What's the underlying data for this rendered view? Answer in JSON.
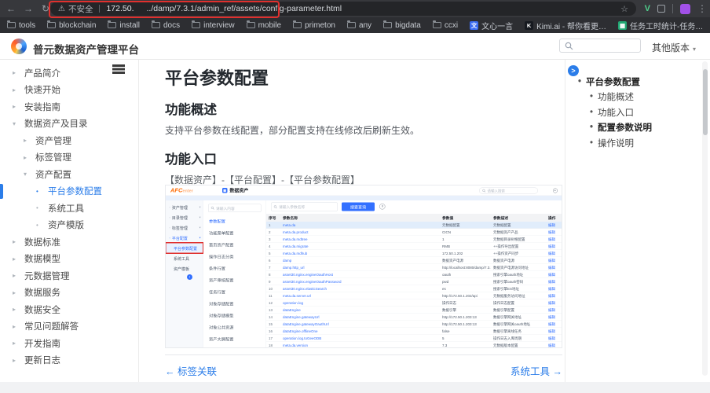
{
  "colors": {
    "accent_blue": "#2b7de9",
    "app_blue": "#3370ff",
    "annotation_red": "#e0302e",
    "brand_orange": "#ff6a00"
  },
  "browser": {
    "back_icon": "←",
    "forward_icon": "→",
    "reload_icon": "↻",
    "star_icon": "☆",
    "menu_icon": "⋮",
    "security_warning_icon": "⚠",
    "security_label": "不安全",
    "url_host": "172.50.",
    "url_path": "../damp/7.3.1/admin_ref/assets/config-parameter.html",
    "extension_v_label": "V",
    "folder_bookmarks": [
      "tools",
      "blockchain",
      "install",
      "docs",
      "interview",
      "mobile",
      "primeton",
      "any",
      "bigdata",
      "ccxi"
    ],
    "site_bookmarks": [
      {
        "label": "文心一言",
        "glyph": "文",
        "color": "#3b6cf0"
      },
      {
        "label": "Kimi.ai - 帮你看更…",
        "glyph": "K",
        "color": "#16191f"
      },
      {
        "label": "任务工时统计-任务…",
        "glyph": "▦",
        "color": "#21a673"
      }
    ]
  },
  "site": {
    "brand": "普元数据资产管理平台",
    "versions_label": "其他版本",
    "versions_caret": "▾"
  },
  "doc_sidebar": {
    "items": [
      {
        "label": "产品简介",
        "level": 0,
        "arrow": "right"
      },
      {
        "label": "快速开始",
        "level": 0,
        "arrow": "right"
      },
      {
        "label": "安装指南",
        "level": 0,
        "arrow": "right"
      },
      {
        "label": "数据资产及目录",
        "level": 0,
        "arrow": "down"
      },
      {
        "label": "资产管理",
        "level": 1,
        "arrow": "right"
      },
      {
        "label": "标签管理",
        "level": 1,
        "arrow": "right"
      },
      {
        "label": "资产配置",
        "level": 1,
        "arrow": "down"
      },
      {
        "label": "平台参数配置",
        "level": 2,
        "arrow": "dot",
        "active": true
      },
      {
        "label": "系统工具",
        "level": 2,
        "arrow": "dot"
      },
      {
        "label": "资产模版",
        "level": 2,
        "arrow": "dot"
      },
      {
        "label": "数据标准",
        "level": 0,
        "arrow": "right"
      },
      {
        "label": "数据模型",
        "level": 0,
        "arrow": "right"
      },
      {
        "label": "元数据管理",
        "level": 0,
        "arrow": "right"
      },
      {
        "label": "数据服务",
        "level": 0,
        "arrow": "right"
      },
      {
        "label": "数据安全",
        "level": 0,
        "arrow": "right"
      },
      {
        "label": "常见问题解答",
        "level": 0,
        "arrow": "right"
      },
      {
        "label": "开发指南",
        "level": 0,
        "arrow": "right"
      },
      {
        "label": "更新日志",
        "level": 0,
        "arrow": "right"
      }
    ]
  },
  "content": {
    "title": "平台参数配置",
    "section1_title": "功能概述",
    "section1_text": "支持平台参数在线配置，部分配置支持在线修改后刷新生效。",
    "section2_title": "功能入口",
    "entry_path": "【数据资产】-【平台配置】-【平台参数配置】"
  },
  "toc": {
    "expand_icon": ">",
    "items": [
      {
        "label": "平台参数配置",
        "level": 0,
        "bold": true
      },
      {
        "label": "功能概述",
        "level": 1,
        "bold": false
      },
      {
        "label": "功能入口",
        "level": 1,
        "bold": false
      },
      {
        "label": "配置参数说明",
        "level": 1,
        "bold": true
      },
      {
        "label": "操作说明",
        "level": 1,
        "bold": false
      }
    ]
  },
  "pager": {
    "prev_arrow": "←",
    "prev": "标签关联",
    "next": "系统工具",
    "next_arrow": "→"
  },
  "app_screenshot": {
    "logo_primary": "AFC",
    "logo_secondary": "enter",
    "top_tab": "数据资产",
    "top_tab_glyph": "▦",
    "top_search_placeholder": "请输入搜索",
    "nav_items": [
      {
        "label": "资产管理",
        "type": "parent"
      },
      {
        "label": "目录管理",
        "type": "parent"
      },
      {
        "label": "标签管理",
        "type": "parent"
      },
      {
        "label": "平台配置",
        "type": "parent",
        "active": true
      },
      {
        "label": "平台参数配置",
        "type": "child",
        "selected": true,
        "annotated": true
      },
      {
        "label": "系统工具",
        "type": "child"
      },
      {
        "label": "资产模板",
        "type": "child"
      }
    ],
    "collapse_icon": "i",
    "list_search_placeholder": "请输入内容",
    "list_items": [
      "参数配置",
      "功能菜单配置",
      "首页资产配置",
      "操作日志分类",
      "条件行置",
      "资产审核配置",
      "任务行置",
      "对象存储配置",
      "对象存储模型",
      "对象公共资源",
      "资产大屏配置"
    ],
    "table_search_placeholder": "请输入参数名称",
    "search_button": "搜索查询",
    "columns": [
      "序号",
      "参数名称",
      "参数值",
      "参数描述",
      "操作"
    ],
    "action_label": "编辑",
    "rows": [
      {
        "name": "meta.da",
        "value": "元数据配置",
        "desc": "元数据配置"
      },
      {
        "name": "meta.da.product",
        "value": "CICN",
        "desc": "元数据资产产品"
      },
      {
        "name": "meta.da.mdtree",
        "value": "1",
        "desc": "元数据目录树根配置"
      },
      {
        "name": "meta.da.migrate",
        "value": "RMB",
        "desc": "++操作导出配置"
      },
      {
        "name": "meta.da.mdhub",
        "value": "172.50.1.202",
        "desc": "++操作资产同步"
      },
      {
        "name": "damp",
        "value": "数据资产电源",
        "desc": "数据资产电源"
      },
      {
        "name": "damp.http_url",
        "value": "http://localhost:8080/damp/7.3.1",
        "desc": "数据资产电源访问地址"
      },
      {
        "name": "asset30.nginx.engineOauthHost",
        "value": "oauth",
        "desc": "搜索引擎oauth地址"
      },
      {
        "name": "asset30.nginx.engineOauthPassword",
        "value": "pwd",
        "desc": "搜索引擎oauth密码"
      },
      {
        "name": "asset30.nginx.elasticSearch",
        "value": "es",
        "desc": "搜索引擎ES地址"
      },
      {
        "name": "meta.da.server.url",
        "value": "http://172.50.1.202/api",
        "desc": "元数据服务访问地址"
      },
      {
        "name": "operation.log",
        "value": "操作日志",
        "desc": "操作日志配置"
      },
      {
        "name": "dataEngine",
        "value": "数据引擎",
        "desc": "数据引擎配置"
      },
      {
        "name": "dataEngine.gatewayUrl",
        "value": "http://172.50.1.203:13",
        "desc": "数据引擎网关地址"
      },
      {
        "name": "dataEngine.gatewayOauthUrl",
        "value": "http://172.50.1.203:13",
        "desc": "数据引擎网关oauth地址"
      },
      {
        "name": "dataEngine.offlineOne",
        "value": "false",
        "desc": "数据引擎离线任务"
      },
      {
        "name": "operation.log.toGeeODB",
        "value": "5",
        "desc": "操作日志入库周期"
      },
      {
        "name": "meta.da.version",
        "value": "7.3",
        "desc": "元数据版本配置"
      }
    ]
  }
}
